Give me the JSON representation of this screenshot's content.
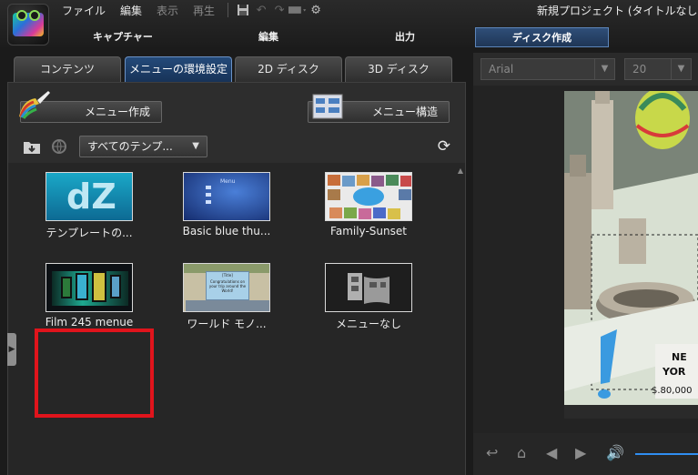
{
  "app": {
    "project_title": "新規プロジェクト (タイトルなし"
  },
  "menu": {
    "items": [
      "ファイル",
      "編集",
      "表示",
      "再生"
    ],
    "icons": [
      "save-icon",
      "undo-icon",
      "redo-icon",
      "screen-icon",
      "gear-icon"
    ]
  },
  "modes": {
    "capture": "キャプチャー",
    "edit": "編集",
    "output": "出力",
    "disc": "ディスク作成"
  },
  "tabs": [
    "コンテンツ",
    "メニューの環境設定",
    "2D ディスク",
    "3D ディスク"
  ],
  "panel": {
    "create_menu_label": "メニュー作成",
    "menu_structure_label": "メニュー構造",
    "template_filter": "すべてのテンプ...",
    "templates": [
      {
        "label": "テンプレートの..."
      },
      {
        "label": "Basic blue thu..."
      },
      {
        "label": "Family-Sunset"
      },
      {
        "label": "Film 245 menue"
      },
      {
        "label": "ワールド モノ..."
      },
      {
        "label": "メニューなし"
      }
    ],
    "thumb_text": {
      "dz": "dZ",
      "basic": "Menu",
      "world_header": "[Title]",
      "world_body": "Congratulations on your trip around the World!"
    }
  },
  "preview": {
    "font_name": "Arial",
    "font_size": "20",
    "sign_text_1": "NE",
    "sign_text_2": "YOR",
    "price_text": "$.80,000"
  },
  "colors": {
    "accent": "#244a7a",
    "highlight": "#e0141c",
    "volume": "#2f8df0"
  }
}
